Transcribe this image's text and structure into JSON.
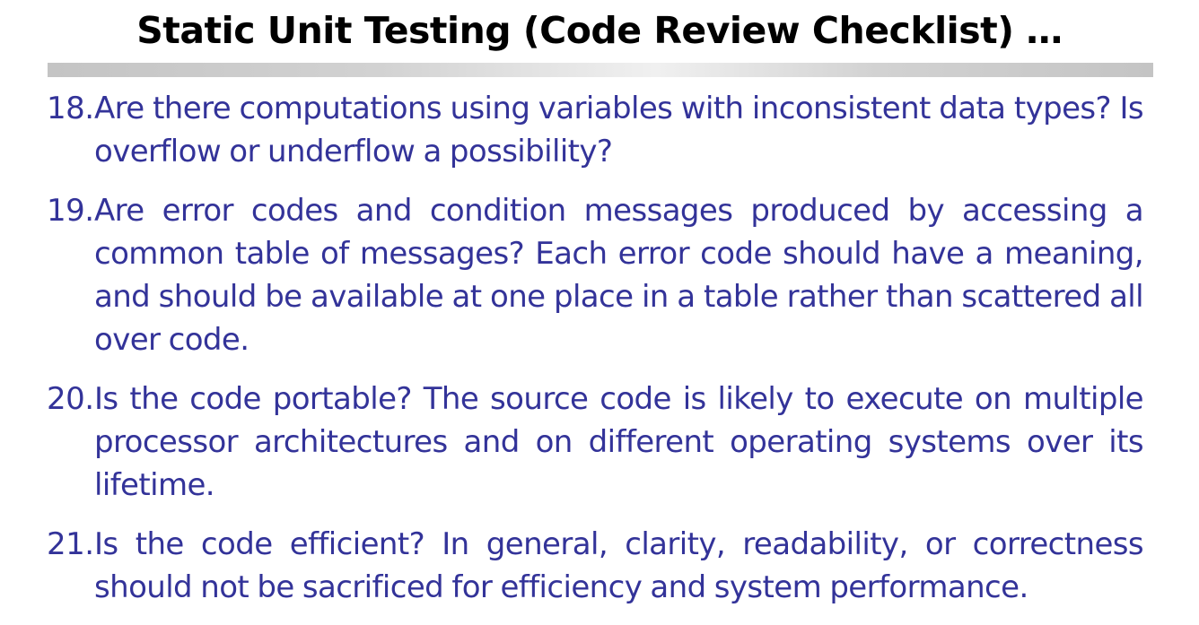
{
  "slide": {
    "title": "Static Unit Testing (Code Review Checklist) …",
    "items": [
      {
        "number": "18.",
        "text": "Are there computations using variables with inconsistent data types? Is overflow or underflow a possibility?"
      },
      {
        "number": "19.",
        "text": "Are error codes and condition messages produced by accessing a common table of messages? Each error code should have a meaning, and should be available at one place in a table rather than scattered all over code."
      },
      {
        "number": "20.",
        "text": "Is the code portable? The source code is likely to execute on multiple processor architectures and on different operating systems over its lifetime."
      },
      {
        "number": "21.",
        "text": "Is the code efficient? In general, clarity, readability, or correctness should not be sacrificed for efficiency and system performance."
      }
    ]
  },
  "colors": {
    "title": "#000000",
    "body_text": "#333399",
    "rule": "#c4c4c4",
    "background": "#ffffff"
  }
}
